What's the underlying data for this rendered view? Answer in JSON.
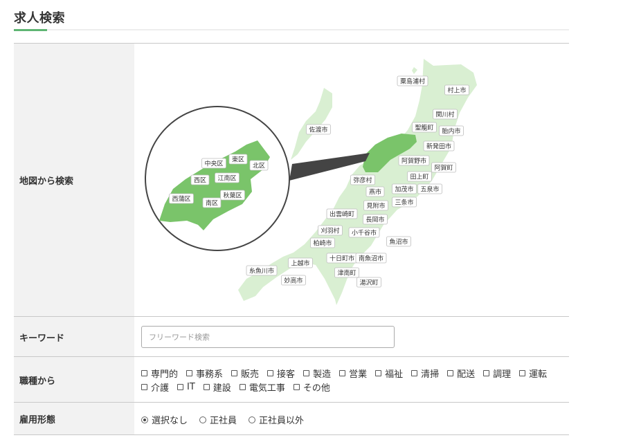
{
  "page": {
    "title": "求人検索"
  },
  "map_section": {
    "label": "地図から検索",
    "zoom_wards": [
      "中央区",
      "東区",
      "北区",
      "西区",
      "江南区",
      "西蒲区",
      "秋葉区",
      "南区"
    ],
    "cities": [
      "粟島浦村",
      "村上市",
      "佐渡市",
      "関川村",
      "聖籠町",
      "胎内市",
      "新発田市",
      "阿賀野市",
      "阿賀町",
      "弥彦村",
      "田上町",
      "燕市",
      "加茂市",
      "五泉市",
      "三条市",
      "見附市",
      "出雲崎町",
      "長岡市",
      "刈羽村",
      "小千谷市",
      "柏崎市",
      "魚沼市",
      "十日町市",
      "南魚沼市",
      "上越市",
      "糸魚川市",
      "津南町",
      "妙高市",
      "湯沢町"
    ],
    "colors": {
      "land": "#d9efd2",
      "land_selected": "#7ac46a",
      "ward_area": "#7ac46a"
    }
  },
  "keyword": {
    "label": "キーワード",
    "placeholder": "フリーワード検索",
    "value": ""
  },
  "job_types": {
    "label": "職種から",
    "items": [
      "専門的",
      "事務系",
      "販売",
      "接客",
      "製造",
      "営業",
      "福祉",
      "清掃",
      "配送",
      "調理",
      "運転",
      "介護",
      "IT",
      "建設",
      "電気工事",
      "その他"
    ]
  },
  "employment": {
    "label": "雇用形態",
    "options": [
      "選択なし",
      "正社員",
      "正社員以外"
    ],
    "selected": "選択なし"
  }
}
